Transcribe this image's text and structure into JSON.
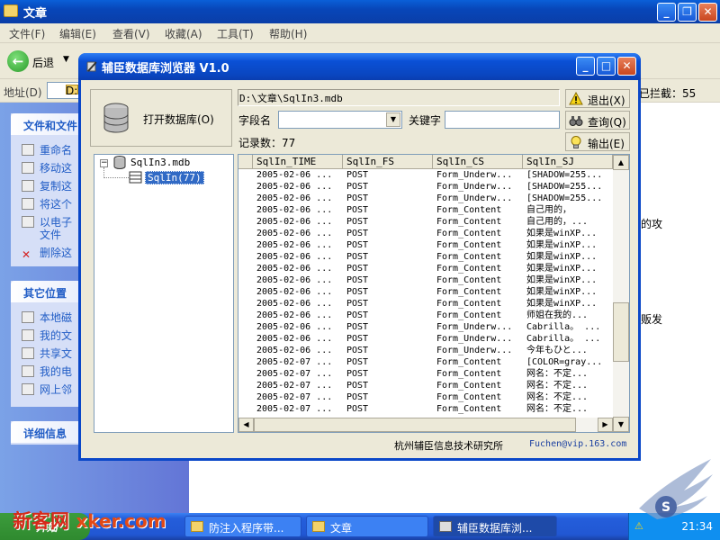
{
  "explorer": {
    "title": "文章",
    "menu": [
      "文件(F)",
      "编辑(E)",
      "查看(V)",
      "收藏(A)",
      "工具(T)",
      "帮助(H)"
    ],
    "back_label": "后退",
    "address_label": "地址(D)",
    "address_value": "D:",
    "blocked_text": "已拦截：55",
    "panels": {
      "file_tasks": {
        "title": "文件和文件",
        "items": [
          "重命名",
          "移动这",
          "复制这",
          "将这个",
          "以电子",
          "文件",
          "删除这"
        ]
      },
      "other_places": {
        "title": "其它位置",
        "items": [
          "本地磁",
          "我的文",
          "共享文",
          "我的电",
          "网上邻"
        ]
      },
      "details": {
        "title": "详细信息"
      }
    },
    "right_fragments": [
      "的攻",
      "贩发"
    ]
  },
  "dialog": {
    "title": "辅臣数据库浏览器 V1.0",
    "open_db_label": "打开数据库(O)",
    "path": "D:\\文章\\SqlIn3.mdb",
    "field_label": "字段名",
    "keyword_label": "关键字",
    "keyword_value": "",
    "record_count": "记录数：77",
    "buttons": {
      "exit": "退出(X)",
      "query": "查询(Q)",
      "export": "输出(E)"
    },
    "tree": {
      "db": "SqlIn3.mdb",
      "table": "SqlIn(77)"
    },
    "grid": {
      "columns": [
        "SqlIn_TIME",
        "SqlIn_FS",
        "SqlIn_CS",
        "SqlIn_SJ"
      ],
      "rows": [
        [
          "2005-02-06 ...",
          "POST",
          "Form_Underw...",
          "[SHADOW=255..."
        ],
        [
          "2005-02-06 ...",
          "POST",
          "Form_Underw...",
          "[SHADOW=255..."
        ],
        [
          "2005-02-06 ...",
          "POST",
          "Form_Underw...",
          "[SHADOW=255..."
        ],
        [
          "2005-02-06 ...",
          "POST",
          "Form_Content",
          "自己用的，"
        ],
        [
          "2005-02-06 ...",
          "POST",
          "Form_Content",
          "自己用的，..."
        ],
        [
          "2005-02-06 ...",
          "POST",
          "Form_Content",
          "如果是winXP..."
        ],
        [
          "2005-02-06 ...",
          "POST",
          "Form_Content",
          "如果是winXP..."
        ],
        [
          "2005-02-06 ...",
          "POST",
          "Form_Content",
          "如果是winXP..."
        ],
        [
          "2005-02-06 ...",
          "POST",
          "Form_Content",
          "如果是winXP..."
        ],
        [
          "2005-02-06 ...",
          "POST",
          "Form_Content",
          "如果是winXP..."
        ],
        [
          "2005-02-06 ...",
          "POST",
          "Form_Content",
          "如果是winXP..."
        ],
        [
          "2005-02-06 ...",
          "POST",
          "Form_Content",
          "如果是winXP..."
        ],
        [
          "2005-02-06 ...",
          "POST",
          "Form_Content",
          "师姐在我的..."
        ],
        [
          "2005-02-06 ...",
          "POST",
          "Form_Underw...",
          "Cabrilla。 ..."
        ],
        [
          "2005-02-06 ...",
          "POST",
          "Form_Underw...",
          "Cabrilla。 ..."
        ],
        [
          "2005-02-06 ...",
          "POST",
          "Form_Underw...",
          "今年もひと..."
        ],
        [
          "2005-02-07 ...",
          "POST",
          "Form_Content",
          "[COLOR=gray..."
        ],
        [
          "2005-02-07 ...",
          "POST",
          "Form_Content",
          "网名：不定..."
        ],
        [
          "2005-02-07 ...",
          "POST",
          "Form_Content",
          "网名：不定..."
        ],
        [
          "2005-02-07 ...",
          "POST",
          "Form_Content",
          "网名：不定..."
        ],
        [
          "2005-02-07 ...",
          "POST",
          "Form_Content",
          "网名：不定..."
        ]
      ]
    },
    "footer_org": "杭州辅臣信息技术研究所",
    "footer_email": "Fuchen@vip.163.com"
  },
  "taskbar": {
    "start_label": "开始",
    "watermark": "新客网",
    "watermark_url": "xker.com",
    "buttons": [
      "防注入程序带...",
      "文章",
      "辅臣数据库浏..."
    ],
    "time": "21:34"
  },
  "colors": {
    "xp_blue": "#0a50d6",
    "selection": "#316ac5",
    "link": "#215dc6"
  }
}
